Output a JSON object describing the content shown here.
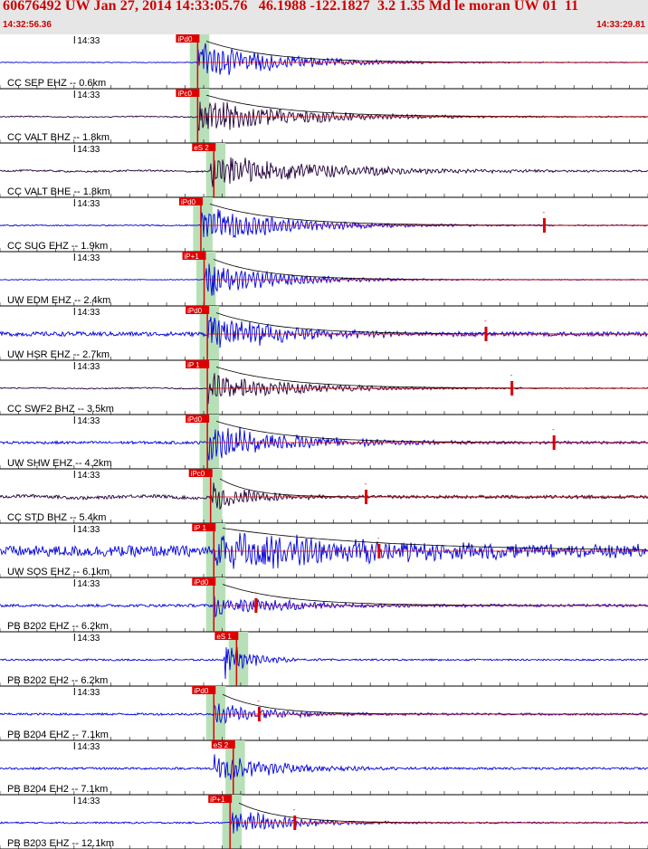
{
  "header": {
    "title": "60676492 UW Jan 27, 2014 14:33:05.76   46.1988 -122.1827  3.2 1.35 Md le moran UW 01  11",
    "start_time": "14:32:56.36",
    "end_time": "14:33:29.81"
  },
  "colors": {
    "header_bg": "#e6e6e6",
    "header_text": "#cc0000",
    "trace_blue": "#0000dd",
    "trace_dark": "#22003a",
    "pick": "#dd0000",
    "pick_window": "#b8e0b8",
    "coda": "#000000",
    "grid": "#000000"
  },
  "chart_data": {
    "type": "seismogram",
    "x_axis": {
      "start": "14:32:56.36",
      "end": "14:33:29.81",
      "tick_label": "14:33",
      "minor_ticks_per_trace": 35
    },
    "panels": [
      {
        "label": "CC SEP EHZ -- 0.6km",
        "phase": "iPd0",
        "color": "blue",
        "event_frac": 0.305,
        "amp": 1.0,
        "decay": 0.12,
        "noise": 0.015,
        "pick_frac": 0.305,
        "extra_pick_frac": null,
        "coda": true
      },
      {
        "label": "CC VALT BHZ -- 1.8km",
        "phase": "iPc0",
        "color": "dark",
        "event_frac": 0.305,
        "amp": 0.95,
        "decay": 0.14,
        "noise": 0.02,
        "pick_frac": 0.305,
        "extra_pick_frac": null,
        "coda": true
      },
      {
        "label": "CC VALT BHE -- 1.8km",
        "phase": "eS 2",
        "color": "dark",
        "event_frac": 0.325,
        "amp": 0.9,
        "decay": 0.16,
        "noise": 0.03,
        "pick_frac": 0.33,
        "extra_pick_frac": null,
        "coda": false
      },
      {
        "label": "CC SUG EHZ -- 1.9km",
        "phase": "iPd0",
        "color": "blue",
        "event_frac": 0.31,
        "amp": 0.9,
        "decay": 0.13,
        "noise": 0.02,
        "pick_frac": 0.31,
        "extra_pick_frac": 0.84,
        "coda": true
      },
      {
        "label": "UW EDM EHZ -- 2.4km",
        "phase": "iP+1",
        "color": "blue",
        "event_frac": 0.315,
        "amp": 1.0,
        "decay": 0.1,
        "noise": 0.015,
        "pick_frac": 0.315,
        "extra_pick_frac": null,
        "coda": true
      },
      {
        "label": "UW HSR EHZ -- 2.7km",
        "phase": "iPd0",
        "color": "blue",
        "event_frac": 0.32,
        "amp": 0.9,
        "decay": 0.12,
        "noise": 0.08,
        "pick_frac": 0.32,
        "extra_pick_frac": 0.75,
        "coda": true
      },
      {
        "label": "CC SWF2 BHZ -- 3.5km",
        "phase": "iP 1",
        "color": "dark",
        "event_frac": 0.32,
        "amp": 0.75,
        "decay": 0.13,
        "noise": 0.02,
        "pick_frac": 0.32,
        "extra_pick_frac": 0.79,
        "coda": true
      },
      {
        "label": "UW SHW EHZ -- 4.2km",
        "phase": "iPd0",
        "color": "blue",
        "event_frac": 0.32,
        "amp": 0.95,
        "decay": 0.13,
        "noise": 0.05,
        "pick_frac": 0.32,
        "extra_pick_frac": 0.855,
        "coda": true
      },
      {
        "label": "CC STD BHZ -- 5.4km",
        "phase": "iPc0",
        "color": "dark",
        "event_frac": 0.325,
        "amp": 0.75,
        "decay": 0.06,
        "noise": 0.06,
        "pick_frac": 0.325,
        "extra_pick_frac": 0.565,
        "coda": true
      },
      {
        "label": "UW SOS EHZ -- 6.1km",
        "phase": "iP 1",
        "color": "blue",
        "event_frac": 0.33,
        "amp": 0.85,
        "decay": 0.3,
        "noise": 0.2,
        "pick_frac": 0.33,
        "extra_pick_frac": 0.585,
        "coda": true
      },
      {
        "label": "PB B202 EHZ -- 6.2km",
        "phase": "iPd0",
        "color": "blue",
        "event_frac": 0.33,
        "amp": 0.55,
        "decay": 0.12,
        "noise": 0.05,
        "pick_frac": 0.33,
        "extra_pick_frac": 0.395,
        "coda": true
      },
      {
        "label": "PB B202 EH2 -- 6.2km",
        "phase": "eS 1",
        "color": "blue",
        "event_frac": 0.345,
        "amp": 0.95,
        "decay": 0.04,
        "noise": 0.03,
        "pick_frac": 0.365,
        "extra_pick_frac": null,
        "coda": false
      },
      {
        "label": "PB B204 EHZ -- 7.1km",
        "phase": "iPd0",
        "color": "blue",
        "event_frac": 0.33,
        "amp": 0.6,
        "decay": 0.08,
        "noise": 0.04,
        "pick_frac": 0.33,
        "extra_pick_frac": 0.4,
        "coda": true
      },
      {
        "label": "PB B204 EH2 -- 7.1km",
        "phase": "eS 2",
        "color": "blue",
        "event_frac": 0.33,
        "amp": 0.7,
        "decay": 0.1,
        "noise": 0.04,
        "pick_frac": 0.36,
        "extra_pick_frac": null,
        "coda": false
      },
      {
        "label": "PB B203 EHZ -- 12.1km",
        "phase": "iP+1",
        "color": "blue",
        "event_frac": 0.355,
        "amp": 0.8,
        "decay": 0.08,
        "noise": 0.03,
        "pick_frac": 0.355,
        "extra_pick_frac": 0.455,
        "coda": true
      }
    ]
  }
}
